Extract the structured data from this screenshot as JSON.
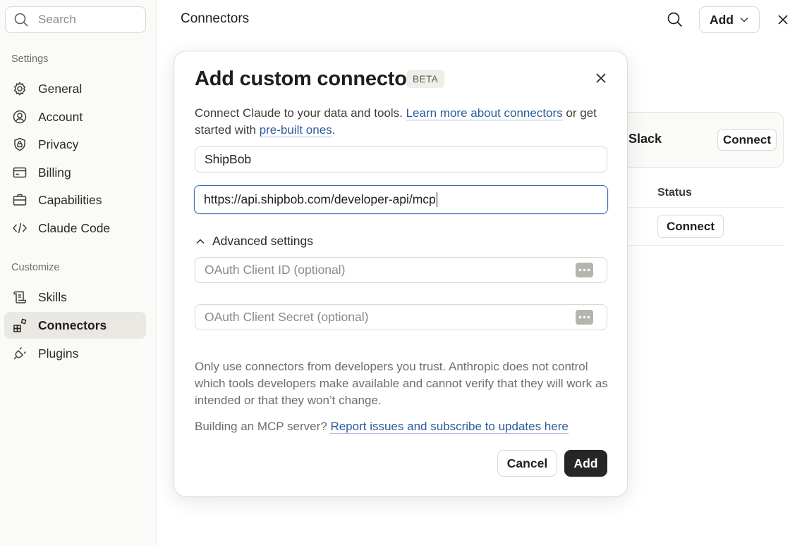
{
  "sidebar": {
    "search_placeholder": "Search",
    "settings_label": "Settings",
    "settings_items": [
      {
        "label": "General",
        "icon": "gear-icon"
      },
      {
        "label": "Account",
        "icon": "user-circle-icon"
      },
      {
        "label": "Privacy",
        "icon": "shield-lock-icon"
      },
      {
        "label": "Billing",
        "icon": "credit-card-icon"
      },
      {
        "label": "Capabilities",
        "icon": "briefcase-icon"
      },
      {
        "label": "Claude Code",
        "icon": "code-icon"
      }
    ],
    "customize_label": "Customize",
    "customize_items": [
      {
        "label": "Skills",
        "icon": "scroll-icon"
      },
      {
        "label": "Connectors",
        "icon": "blocks-icon",
        "active": true
      },
      {
        "label": "Plugins",
        "icon": "plug-icon"
      }
    ]
  },
  "header": {
    "title": "Connectors",
    "add_label": "Add"
  },
  "background": {
    "card_title": "Slack",
    "card_connect": "Connect",
    "status_header": "Status",
    "row_connect": "Connect"
  },
  "modal": {
    "title": "Add custom connector",
    "badge": "BETA",
    "desc_prefix": "Connect Claude to your data and tools. ",
    "desc_link1": "Learn more about connectors",
    "desc_mid": " or get started with ",
    "desc_link2": "pre-built ones",
    "desc_suffix": ".",
    "name_value": "ShipBob",
    "url_value": "https://api.shipbob.com/developer-api/mcp",
    "advanced_label": "Advanced settings",
    "client_id_placeholder": "OAuth Client ID (optional)",
    "client_secret_placeholder": "OAuth Client Secret (optional)",
    "warning": "Only use connectors from developers you trust. Anthropic does not control which tools developers make available and cannot verify that they will work as intended or that they won’t change.",
    "mcp_prefix": "Building an MCP server? ",
    "mcp_link": "Report issues and subscribe to updates here",
    "cancel_label": "Cancel",
    "add_label": "Add"
  }
}
